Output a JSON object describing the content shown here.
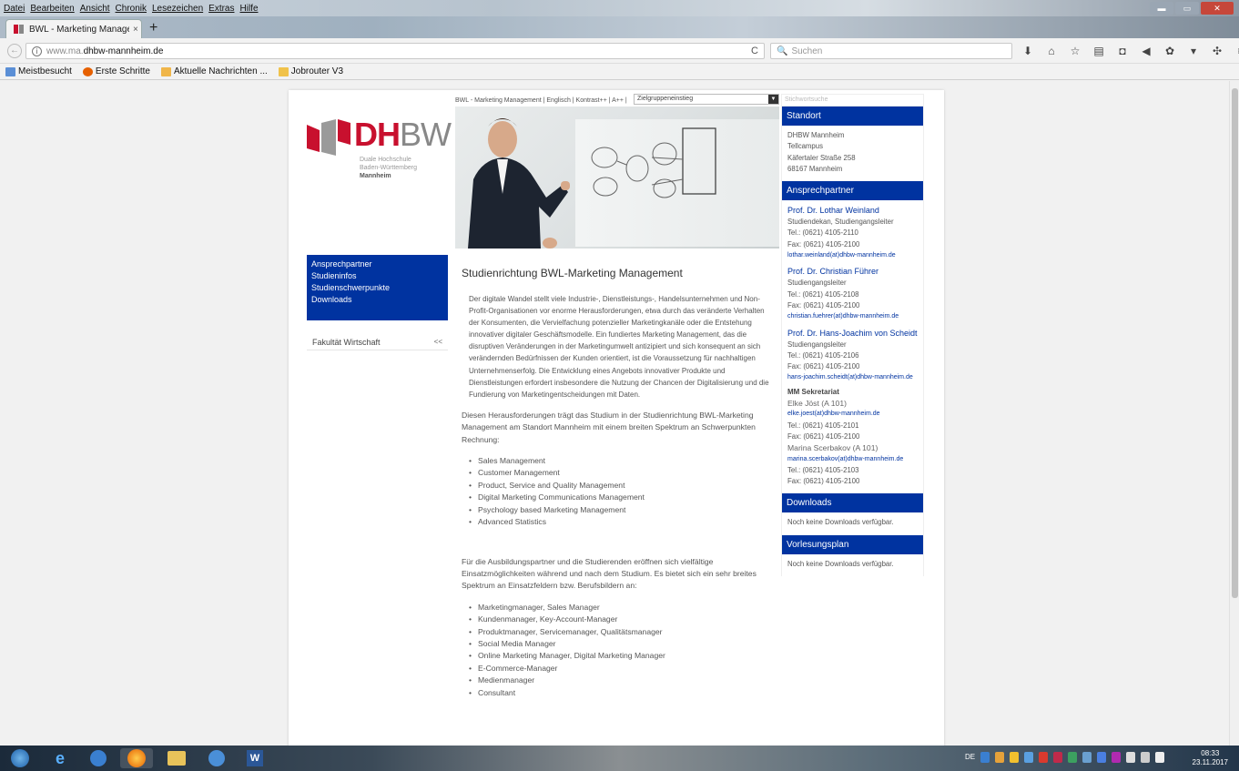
{
  "browser": {
    "menu": [
      "Datei",
      "Bearbeiten",
      "Ansicht",
      "Chronik",
      "Lesezeichen",
      "Extras",
      "Hilfe"
    ],
    "tab_title": "BWL - Marketing Managem",
    "tab_close": "×",
    "new_tab": "+",
    "url_prefix": "www.ma.",
    "url_host": "dhbw-mannheim.de",
    "search_placeholder": "Suchen",
    "bookmarks": [
      "Meistbesucht",
      "Erste Schritte",
      "Aktuelle Nachrichten ...",
      "Jobrouter V3"
    ]
  },
  "site": {
    "topnav_text": "BWL - Marketing Management | Englisch | Kontrast++ | A++ |",
    "target_group_select": "Zielgruppeneinstieg",
    "search_placeholder": "Stichwortsuche",
    "logo": {
      "word_red": "DH",
      "word_grey": "BW",
      "line1": "Duale Hochschule",
      "line2": "Baden-Württemberg",
      "line3": "Mannheim"
    },
    "leftnav": [
      "Ansprechpartner",
      "Studieninfos",
      "Studienschwerpunkte",
      "Downloads"
    ],
    "faculty": {
      "label": "Fakultät Wirtschaft",
      "collapse": "<<"
    },
    "content": {
      "title": "Studienrichtung BWL-Marketing Management",
      "intro": "Der digitale Wandel stellt viele Industrie-, Dienstleistungs-, Handelsunternehmen und Non-Profit-Organisationen vor enorme Herausforderungen, etwa durch das veränderte Verhalten der Konsumenten, die Vervielfachung potenzieller Marketingkanäle oder die Entstehung innovativer digitaler Geschäftsmodelle. Ein fundiertes Marketing Management, das die disruptiven Veränderungen in der Marketingumwelt antizipiert und sich konsequent an sich verändernden Bedürfnissen der Kunden orientiert, ist die Voraussetzung für nachhaltigen Unternehmenserfolg. Die Entwicklung eines Angebots innovativer Produkte und Dienstleistungen erfordert insbesondere die Nutzung der Chancen der Digitalisierung und die Fundierung von Marketingentscheidungen mit Daten.",
      "para2": "Diesen Herausforderungen trägt das Studium in der Studienrichtung BWL-Marketing Management am Standort Mannheim mit einem breiten Spektrum an Schwerpunkten Rechnung:",
      "focus_list": [
        "Sales Management",
        "Customer Management",
        "Product, Service and Quality Management",
        "Digital Marketing Communications Management",
        "Psychology based Marketing Management",
        "Advanced Statistics"
      ],
      "para3": "Für die Ausbildungspartner und die Studierenden eröffnen sich vielfältige Einsatzmöglichkeiten während und nach dem Studium. Es bietet sich ein sehr breites Spektrum an Einsatzfeldern bzw. Berufsbildern an:",
      "jobs_list": [
        "Marketingmanager, Sales Manager",
        "Kundenmanager, Key-Account-Manager",
        "Produktmanager, Servicemanager, Qualitätsmanager",
        "Social Media Manager",
        "Online Marketing Manager, Digital Marketing Manager",
        "E-Commerce-Manager",
        "Medienmanager",
        "Consultant"
      ]
    },
    "sidebar": {
      "standort": {
        "title": "Standort",
        "lines": [
          "DHBW Mannheim",
          "Tellcampus",
          "Käfertaler Straße 258",
          "68167 Mannheim"
        ]
      },
      "contacts_title": "Ansprechpartner",
      "contacts": [
        {
          "name": "Prof. Dr. Lothar Weinland",
          "role": "Studiendekan, Studiengangsleiter",
          "tel": "Tel.: (0621) 4105-2110",
          "fax": "Fax: (0621) 4105-2100",
          "email": "lothar.weinland(at)dhbw-mannheim.de"
        },
        {
          "name": "Prof. Dr. Christian Führer",
          "role": "Studiengangsleiter",
          "tel": "Tel.: (0621) 4105-2108",
          "fax": "Fax: (0621) 4105-2100",
          "email": "christian.fuehrer(at)dhbw-mannheim.de"
        },
        {
          "name": "Prof. Dr. Hans-Joachim von Scheidt",
          "role": "Studiengangsleiter",
          "tel": "Tel.: (0621) 4105-2106",
          "fax": "Fax: (0621) 4105-2100",
          "email": "hans-joachim.scheidt(at)dhbw-mannheim.de"
        }
      ],
      "secretariat": {
        "title": "MM Sekretariat",
        "people": [
          {
            "name": "Elke Jöst (A 101)",
            "email": "elke.joest(at)dhbw-mannheim.de",
            "tel": "Tel.: (0621) 4105-2101",
            "fax": "Fax: (0621) 4105-2100"
          },
          {
            "name": "Marina Scerbakov (A 101)",
            "email": "marina.scerbakov(at)dhbw-mannheim.de",
            "tel": "Tel.: (0621) 4105-2103",
            "fax": "Fax: (0621) 4105-2100"
          }
        ]
      },
      "downloads": {
        "title": "Downloads",
        "text": "Noch keine Downloads verfügbar."
      },
      "lecture_plan": {
        "title": "Vorlesungsplan",
        "text": "Noch keine Downloads verfügbar."
      }
    }
  },
  "taskbar": {
    "lang": "DE",
    "time": "08:33",
    "date": "23.11.2017"
  }
}
